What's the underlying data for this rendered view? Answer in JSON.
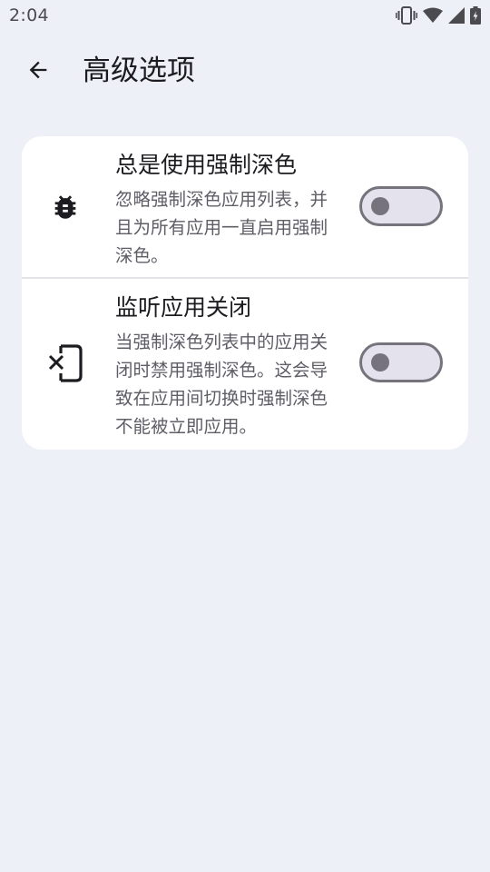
{
  "status_bar": {
    "time": "2:04",
    "icons": [
      "vibrate-icon",
      "wifi-icon",
      "signal-icon",
      "battery-charging-icon"
    ]
  },
  "app_bar": {
    "back_icon": "arrow-left-icon",
    "title": "高级选项"
  },
  "settings": [
    {
      "icon": "bug-icon",
      "title": "总是使用强制深色",
      "summary": "忽略强制深色应用列表，并且为所有应用一直启用强制深色。",
      "enabled": false
    },
    {
      "icon": "app-close-icon",
      "title": "监听应用关闭",
      "summary": "当强制深色列表中的应用关闭时禁用强制深色。这会导致在应用间切换时强制深色不能被立即应用。",
      "enabled": false
    }
  ],
  "colors": {
    "background": "#eef0f8",
    "card": "#ffffff",
    "switch_outline": "#76737c",
    "switch_track": "#e4e2ec"
  }
}
